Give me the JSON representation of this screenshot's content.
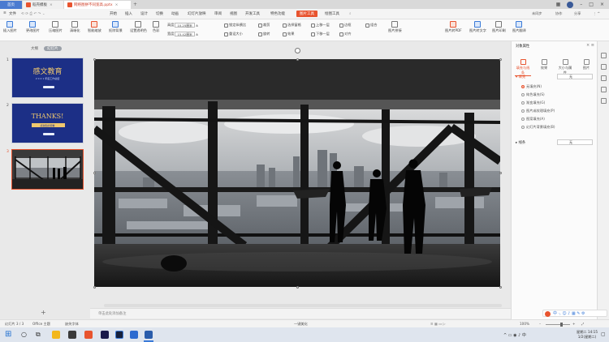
{
  "tabs": {
    "home": "首页",
    "doc1": "稻壳模板",
    "doc2": "网络图拼不同宽高.pptx"
  },
  "menus": [
    "文件",
    "开始",
    "插入",
    "设计",
    "切换",
    "动画",
    "幻灯片放映",
    "审阅",
    "视图",
    "开发工具",
    "特色功能",
    "图片工具",
    "绘图工具"
  ],
  "menu_active": "图片工具",
  "menu_right": [
    "未同步",
    "协作",
    "分享"
  ],
  "ribbon": {
    "row1": [
      "插入图片",
      "更改图片",
      "压缩图片",
      "清晰化",
      "智能缩放",
      "抠除背景",
      "设置透明色",
      "色彩",
      "裁剪",
      "旋转",
      "对齐",
      "组合",
      "选择窗格",
      "图片拼接",
      "图片转PDF",
      "图片转文字",
      "图片印刷",
      "图片翻译"
    ],
    "height_label": "高度",
    "width_label": "宽度",
    "height_value": "10.25厘米",
    "width_value": "15.42厘米",
    "lock_ratio": "锁定纵横比",
    "reset_size": "重设大小",
    "effects": "效果",
    "border": "边框",
    "bring_front": "上移一层",
    "send_back": "下移一层"
  },
  "left_panel": {
    "tab_outline": "大纲",
    "tab_slides": "幻灯片",
    "slide_numbers": [
      "1",
      "2",
      "3"
    ],
    "slide1_title": "感文教育",
    "slide1_sub": "2 0 2 1 年度工作总结",
    "slide2_title": "THANKS!",
    "slide2_sub": "感谢您的观看",
    "add_slide": "+"
  },
  "notes_placeholder": "单击此处添加备注",
  "right_pane": {
    "title": "对象属性",
    "tabs": [
      "填充与线条",
      "效果",
      "大小与属性",
      "图片"
    ],
    "fill_label": "填充",
    "fill_value": "无",
    "fill_options": [
      "无填充(N)",
      "纯色填充(S)",
      "渐变填充(G)",
      "图片或纹理填充(P)",
      "图案填充(A)",
      "幻灯片背景填充(B)"
    ],
    "line_label": "线条",
    "line_value": "无"
  },
  "statusbar": {
    "slide_info": "幻灯片 3 / 3",
    "theme": "Office 主题",
    "missing_font": "缺失字体",
    "smart_beauty": "一键美化",
    "zoom": "100%"
  },
  "taskbar": {
    "time": "星期二 14:15",
    "date": "1/2(星期二)"
  },
  "colors": {
    "accent": "#e8542f",
    "slide_blue": "#1c2f86",
    "taskbar": "#dfe5ee"
  }
}
